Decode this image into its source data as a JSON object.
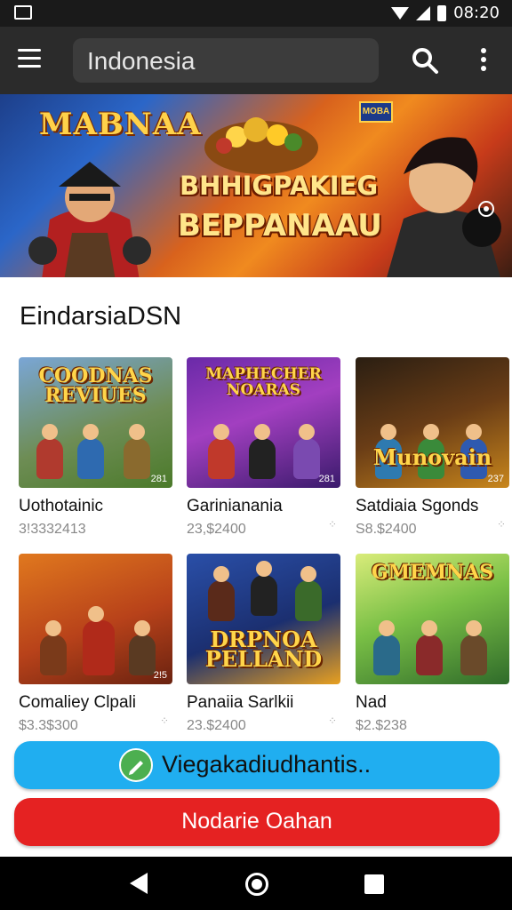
{
  "status_bar": {
    "time": "08:20",
    "icons": [
      "image-icon",
      "wifi-icon",
      "signal-icon",
      "battery-icon"
    ]
  },
  "app_bar": {
    "menu_icon": "hamburger-menu-icon",
    "search_text": "Indonesia",
    "search_icon": "search-icon",
    "more_icon": "more-vert-icon"
  },
  "banner": {
    "logo_text": "MABNAA",
    "title_line1": "BHHIGPAKIEG",
    "title_line2": "BEPPANAAU",
    "corner_logo": "MOBA"
  },
  "section": {
    "title": "EindarsiaDSN"
  },
  "games": [
    {
      "name": "Uothotainic",
      "price": "3!3332413",
      "thumb_label": "COODNAS REVIUES",
      "corner": "281"
    },
    {
      "name": "Garinianania",
      "price": "23,$2400",
      "thumb_label": "MAPHECHER NOARAS",
      "corner": "281"
    },
    {
      "name": "Satdiaia Sgonds",
      "price": "S8.$2400",
      "thumb_label": "Munovain",
      "corner": "237"
    },
    {
      "name": "Comaliey Clpali",
      "price": "$3.3$300",
      "thumb_label": "",
      "corner": "2!5"
    },
    {
      "name": "Panaiia Sarlkii",
      "price": "23.$2400",
      "thumb_label": "DRPNOA PELLAND",
      "corner": ""
    },
    {
      "name": "Nad",
      "price": "$2.$238",
      "thumb_label": "GMEMNAS",
      "corner": ""
    }
  ],
  "buttons": {
    "primary_label": "Viegakadiudhantis..",
    "primary_icon": "pencil-icon",
    "secondary_label": "Nodarie Oahan"
  },
  "nav": {
    "back": "back-icon",
    "home": "home-icon",
    "recent": "recent-apps-icon"
  },
  "colors": {
    "accent_blue": "#20aef0",
    "accent_red": "#e52222",
    "app_bar": "#2b2b2b"
  }
}
